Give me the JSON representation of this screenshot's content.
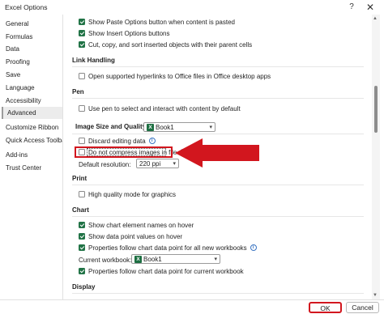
{
  "window": {
    "title": "Excel Options",
    "help_glyph": "?",
    "close_glyph": "✕"
  },
  "sidebar": {
    "items": [
      {
        "label": "General"
      },
      {
        "label": "Formulas"
      },
      {
        "label": "Data"
      },
      {
        "label": "Proofing"
      },
      {
        "label": "Save"
      },
      {
        "label": "Language"
      },
      {
        "label": "Accessibility"
      },
      {
        "label": "Advanced",
        "active": true
      },
      {
        "label": "Customize Ribbon"
      },
      {
        "label": "Quick Access Toolbar"
      },
      {
        "label": "Add-ins"
      },
      {
        "label": "Trust Center"
      }
    ]
  },
  "cut_copy": {
    "opt1": "Show Paste Options button when content is pasted",
    "opt2": "Show Insert Options buttons",
    "opt3": "Cut, copy, and sort inserted objects with their parent cells"
  },
  "link_handling": {
    "heading": "Link Handling",
    "opt1": "Open supported hyperlinks to Office files in Office desktop apps"
  },
  "pen": {
    "heading": "Pen",
    "opt1": "Use pen to select and interact with content by default"
  },
  "image_size": {
    "heading": "Image Size and Quality",
    "workbook": "Book1",
    "discard_label": "Discard editing data",
    "no_compress_label": "Do not compress images in file",
    "resolution_label": "Default resolution:",
    "resolution_value": "220 ppi"
  },
  "print": {
    "heading": "Print",
    "opt1": "High quality mode for graphics"
  },
  "chart": {
    "heading": "Chart",
    "opt1": "Show chart element names on hover",
    "opt2": "Show data point values on hover",
    "opt3": "Properties follow chart data point for all new workbooks",
    "current_label": "Current workbook:",
    "current_value": "Book1",
    "opt4": "Properties follow chart data point for current workbook"
  },
  "display": {
    "heading": "Display"
  },
  "footer": {
    "ok_label": "OK",
    "cancel_label": "Cancel"
  },
  "colors": {
    "accent": "#217346",
    "annotation": "#d2161e",
    "excel_green": "#1d6f42"
  }
}
